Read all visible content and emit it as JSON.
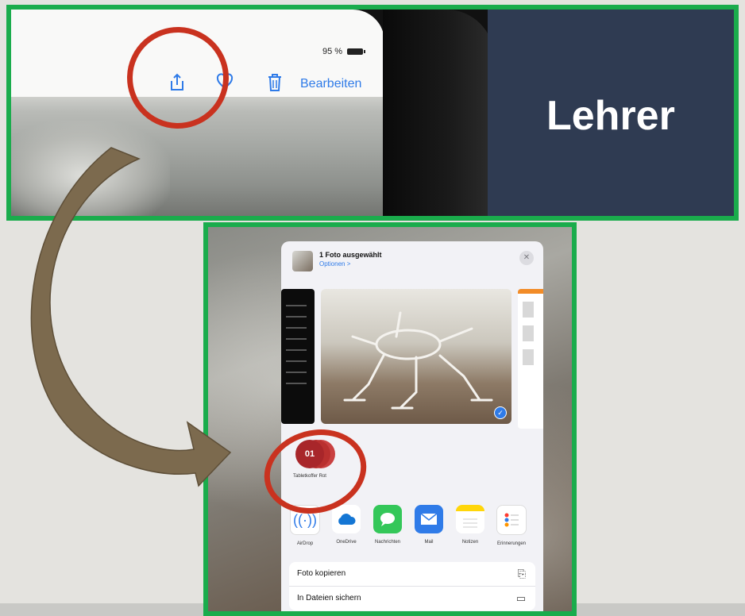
{
  "top_panel": {
    "status_text": "95 %",
    "edit_label": "Bearbeiten",
    "icons": [
      "share-icon",
      "heart-icon",
      "trash-icon"
    ],
    "side_title": "Lehrer"
  },
  "share_sheet": {
    "title": "1 Foto ausgewählt",
    "options_link": "Optionen >",
    "close_icon": "close-icon",
    "airdrop_target": {
      "badge": "01",
      "name": "Tabletkoffer Rot"
    },
    "apps": [
      {
        "label": "AirDrop",
        "icon": "airdrop-icon",
        "color": "#ffffff"
      },
      {
        "label": "OneDrive",
        "icon": "onedrive-icon",
        "color": "#ffffff"
      },
      {
        "label": "Nachrichten",
        "icon": "messages-icon",
        "color": "#34c759"
      },
      {
        "label": "Mail",
        "icon": "mail-icon",
        "color": "#2f7be8"
      },
      {
        "label": "Notizen",
        "icon": "notes-icon",
        "color": "#ffd60a"
      },
      {
        "label": "Erinnerungen",
        "icon": "reminders-icon",
        "color": "#ffffff"
      }
    ],
    "actions": [
      {
        "label": "Foto kopieren",
        "icon": "copy-icon"
      },
      {
        "label": "In Dateien sichern",
        "icon": "folder-icon"
      }
    ]
  },
  "colors": {
    "frame_green": "#1aac4c",
    "annotation_red": "#c9321f",
    "arrow_brown": "#7c6a4e",
    "lehrer_bg": "#2f3b52",
    "ios_blue": "#2f7be8"
  }
}
